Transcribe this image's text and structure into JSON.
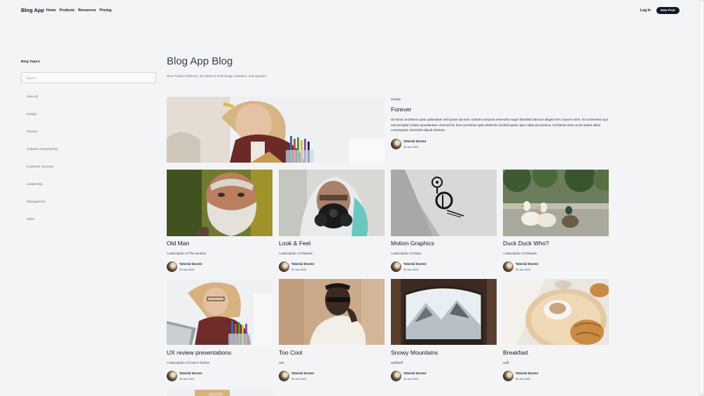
{
  "header": {
    "app_name": "Blog App",
    "nav": [
      "Home",
      "Products",
      "Resources",
      "Pricing"
    ],
    "login_label": "Log In",
    "new_post_label": "New Post"
  },
  "sidebar": {
    "title": "Blog Topics",
    "search_placeholder": "Search",
    "topics": [
      "View all",
      "Design",
      "Product",
      "Software Engineering",
      "Customer Success",
      "Leadership",
      "Management",
      "Other"
    ]
  },
  "main": {
    "title": "Blog App Blog",
    "subtitle": "New Product features, the latest in technology, solutions, and updates."
  },
  "featured": {
    "category": "Design",
    "title": "Forever",
    "excerpt": "Sit minus architecto quas quibusdam sed ipsam aut eum. Dolores tempora reiciendis magni blanditiis laborum aliquid rem corporis enim. Et consectetur quo sed excepturi soluta repudiandae commodi id. Eum possimus optio distinctio incidunt quasi optio culpa accusamus. Architecto esse ut aut autem ullam consequatur reiciendis aliquid dolorum.",
    "author": "Tutorial Doctor",
    "date": "20 Jan 2022",
    "image": "woman-with-pencils-laptop"
  },
  "posts": [
    {
      "title": "Old Man",
      "description": "A description of The window",
      "author": "Tutorial Doctor",
      "date": "20 Jan 2022",
      "image": "bearded-old-man"
    },
    {
      "title": "Look & Feel",
      "description": "A description of Glasses",
      "author": "Tutorial Doctor",
      "date": "20 Jan 2022",
      "image": "man-in-gas-mask"
    },
    {
      "title": "Motion Graphics",
      "description": "A description of Glass",
      "author": "Tutorial Doctor",
      "date": "20 Jan 2022",
      "image": "logo-business-card"
    },
    {
      "title": "Duck Duck Who?",
      "description": "A description of Glasses",
      "author": "Tutorial Doctor",
      "date": "20 Jan 2022",
      "image": "ducks-on-path"
    },
    {
      "title": "UX review presentations",
      "description": "A description of Color's Stories",
      "author": "Tutorial Doctor",
      "date": "20 Jan 2022",
      "image": "woman-with-pencils-laptop"
    },
    {
      "title": "Too Cool",
      "description": "Hat",
      "author": "Tutorial Doctor",
      "date": "20 Jan 2022",
      "image": "man-in-sunglasses"
    },
    {
      "title": "Snowy Mountains",
      "description": "asdfasdf",
      "author": "Tutorial Doctor",
      "date": "20 Jan 2022",
      "image": "mountains-through-window"
    },
    {
      "title": "Breakfast",
      "description": "asdf",
      "author": "Tutorial Doctor",
      "date": "20 Jan 2022",
      "image": "coffee-and-croissant"
    }
  ]
}
